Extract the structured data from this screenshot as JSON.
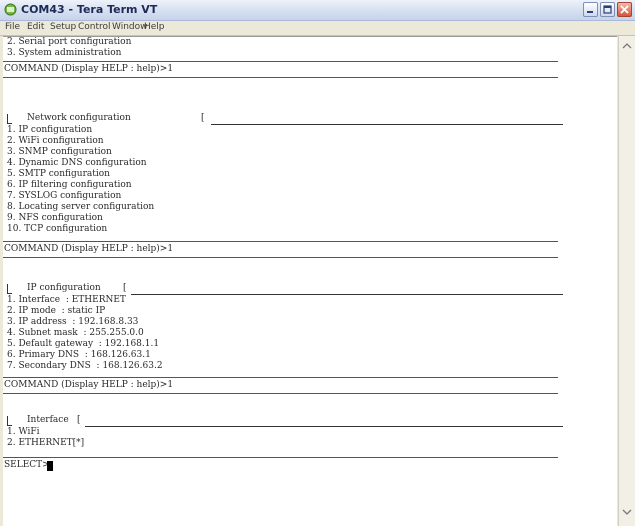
{
  "window": {
    "title": "COM43 - Tera Term VT"
  },
  "menu": [
    "File",
    "Edit",
    "Setup",
    "Control",
    "Window",
    "Help"
  ],
  "terminal": {
    "top_lines": [
      "2. Serial port configuration",
      "3. System administration"
    ],
    "command_prompt": "COMMAND (Display HELP : help)>1",
    "network_menu": {
      "title": "Network configuration",
      "items": [
        "1. IP configuration",
        "2. WiFi configuration",
        "3. SNMP configuration",
        "4. Dynamic DNS configuration",
        "5. SMTP configuration",
        "6. IP filtering configuration",
        "7. SYSLOG configuration",
        "8. Locating server configuration",
        "9. NFS configuration",
        "10. TCP configuration"
      ]
    },
    "ip_menu": {
      "title": "IP configuration",
      "items": [
        "1. Interface  : ETHERNET",
        "2. IP mode  : static IP",
        "3. IP address  : 192.168.8.33",
        "4. Subnet mask  : 255.255.0.0",
        "5. Default gateway  : 192.168.1.1",
        "6. Primary DNS  : 168.126.63.1",
        "7. Secondary DNS  : 168.126.63.2"
      ]
    },
    "interface_menu": {
      "title": "Interface",
      "items": [
        "1. WiFi",
        "2. ETHERNET[*]"
      ]
    },
    "select_prompt": "SELECT>"
  }
}
